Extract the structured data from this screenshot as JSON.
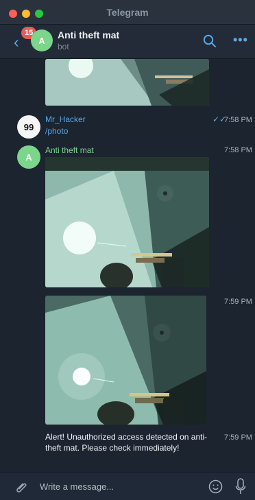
{
  "window": {
    "title": "Telegram"
  },
  "header": {
    "unread_count": "15",
    "avatar_letter": "A",
    "chat_name": "Anti theft mat",
    "chat_status": "bot"
  },
  "messages": [
    {
      "sender": "Mr_Hacker",
      "avatar": "99",
      "text": "/photo",
      "time": "7:58 PM",
      "status": "read-double-check"
    },
    {
      "sender": "Anti theft mat",
      "avatar": "A",
      "time": "7:58 PM",
      "type": "photo"
    },
    {
      "time": "7:59 PM",
      "type": "photo"
    },
    {
      "text": "Alert! Unauthorized access detected on anti-theft mat. Please check immediately!",
      "time": "7:59 PM"
    }
  ],
  "composer": {
    "placeholder": "Write a message..."
  },
  "icons": [
    "back-chevron-icon",
    "search-icon",
    "more-icon",
    "attachment-icon",
    "emoji-icon",
    "microphone-icon"
  ],
  "colors": {
    "accent": "#5aa7e8",
    "bot_green": "#7bd58a",
    "background": "#1c2430",
    "badge": "#e85a5a"
  }
}
